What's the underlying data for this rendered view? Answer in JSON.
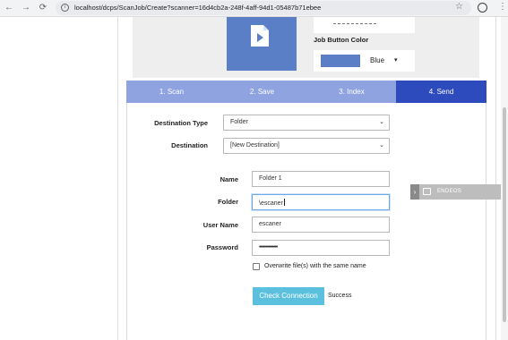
{
  "browser": {
    "url": "localhost/dcps/ScanJob/Create?scanner=16d4cb2a-248f-4aff-94d1-05487b71ebee",
    "back_icon": "←",
    "forward_icon": "→",
    "reload_icon": "⟳",
    "info_icon": "i",
    "star_icon": "☆",
    "menu_icon": "⋮"
  },
  "job_button": {
    "color_label": "Job Button Color",
    "color_value": "Blue",
    "color_hex": "#5b7fc6",
    "caret": "▾"
  },
  "steps": [
    {
      "label": "1. Scan",
      "active": false
    },
    {
      "label": "2. Save",
      "active": false
    },
    {
      "label": "3. Index",
      "active": false
    },
    {
      "label": "4. Send",
      "active": true
    }
  ],
  "form": {
    "destination_type": {
      "label": "Destination Type",
      "value": "Folder"
    },
    "destination": {
      "label": "Destination",
      "value": "[New Destination]"
    },
    "name": {
      "label": "Name",
      "value": "Folder 1"
    },
    "folder": {
      "label": "Folder",
      "value": "\\escaner"
    },
    "user_name": {
      "label": "User Name",
      "value": "escaner"
    },
    "password": {
      "label": "Password",
      "value": "••••••••••••••"
    },
    "overwrite": {
      "label": "Overwrite file(s) with the same name",
      "checked": false
    },
    "chevron": "⌄"
  },
  "check_connection": {
    "label": "Check Connection",
    "status": "Success"
  },
  "side_tab": {
    "label": "ENDEOS",
    "arrow": "›"
  },
  "colors": {
    "step_bar": "#8fa3e0",
    "step_active": "#2e4bbd",
    "check_button": "#5bc0de"
  }
}
